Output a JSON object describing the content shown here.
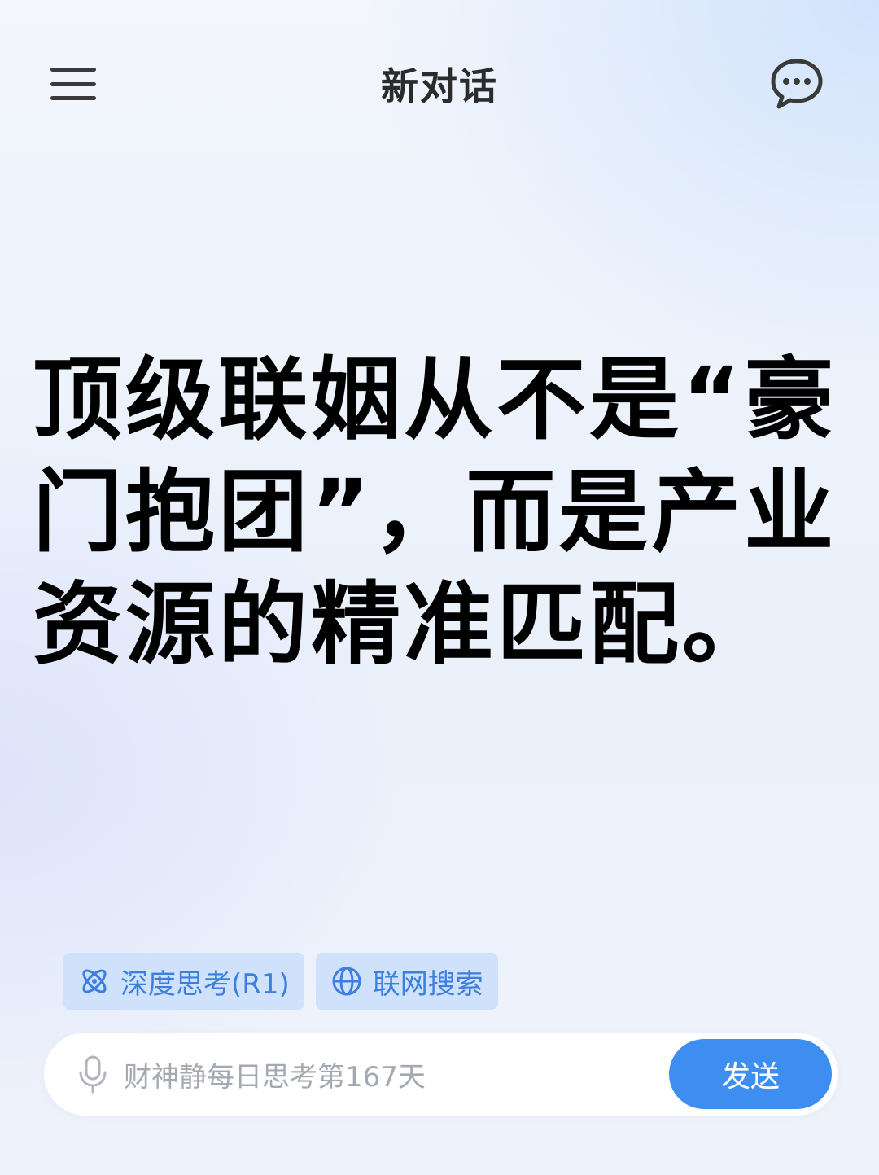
{
  "header": {
    "title": "新对话",
    "menu_icon": "hamburger-menu-icon",
    "chat_icon": "chat-bubble-icon"
  },
  "headline": {
    "text": "顶级联姻从不是“豪门抱团”，而是产业资源的精准匹配。"
  },
  "chips": [
    {
      "label": "深度思考(R1)",
      "icon": "atom-icon"
    },
    {
      "label": "联网搜索",
      "icon": "globe-icon"
    }
  ],
  "input": {
    "text": "财神静每日思考第167天",
    "mic_icon": "microphone-icon",
    "send_label": "发送"
  },
  "colors": {
    "accent": "#3d8ef0",
    "chip_bg": "#cfe1fb",
    "chip_text": "#3d7fe0",
    "headline": "#000000"
  }
}
